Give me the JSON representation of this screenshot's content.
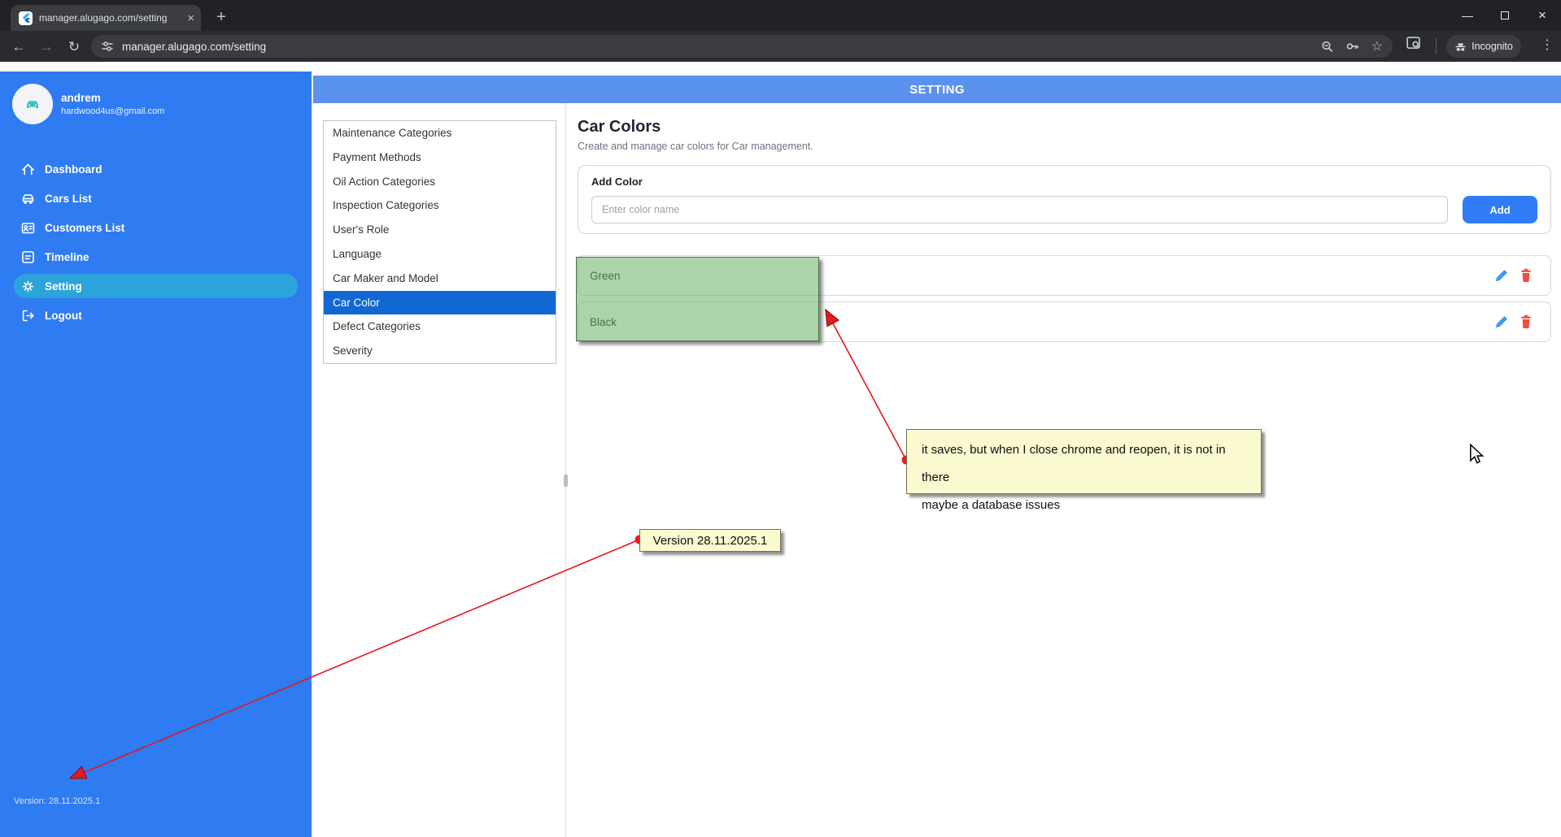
{
  "browser": {
    "tab_title": "manager.alugago.com/setting",
    "url": "manager.alugago.com/setting",
    "incognito_label": "Incognito",
    "glyphs": {
      "close_tab": "×",
      "new_tab": "+",
      "minimize": "—",
      "close_window": "×",
      "back": "←",
      "forward": "→",
      "reload": "↻",
      "star": "☆",
      "menu_dots": "⋮"
    }
  },
  "sidebar": {
    "user": {
      "name": "andrem",
      "email": "hardwood4us@gmail.com"
    },
    "items": [
      {
        "label": "Dashboard"
      },
      {
        "label": "Cars List"
      },
      {
        "label": "Customers List"
      },
      {
        "label": "Timeline"
      },
      {
        "label": "Setting"
      },
      {
        "label": "Logout"
      }
    ],
    "version_label": "Version: 28.11.2025.1"
  },
  "header": {
    "title": "SETTING"
  },
  "settings_menu": {
    "items": [
      {
        "label": "Maintenance Categories"
      },
      {
        "label": "Payment Methods"
      },
      {
        "label": "Oil Action Categories"
      },
      {
        "label": "Inspection Categories"
      },
      {
        "label": "User's Role"
      },
      {
        "label": "Language"
      },
      {
        "label": "Car Maker and Model"
      },
      {
        "label": "Car Color"
      },
      {
        "label": "Defect Categories"
      },
      {
        "label": "Severity"
      }
    ]
  },
  "main": {
    "title": "Car Colors",
    "subtitle": "Create and manage car colors for Car management.",
    "add_card": {
      "title": "Add Color",
      "input_placeholder": "Enter color name",
      "input_value": "",
      "button_label": "Add"
    },
    "colors": [
      {
        "name": "Green"
      },
      {
        "name": "Black"
      }
    ]
  },
  "annotations": {
    "note1": {
      "line1": "it saves, but when I close chrome and reopen, it is not in there",
      "line2": "maybe a database issues"
    },
    "note2": {
      "text": "Version 28.11.2025.1"
    }
  },
  "theme": {
    "sidebar_blue": "#2F7BF2",
    "active_pill": "#2BA4DC",
    "header_blue": "#5B92ED",
    "selected_menu": "#1268D2",
    "button_blue": "#2F7CF6",
    "edit_icon": "#3B9AF2",
    "delete_icon": "#EF4B40",
    "note_yellow": "#FBF9D0",
    "annotation_red": "#E8151D",
    "highlight_green": "rgba(92,168,88,0.50)"
  }
}
